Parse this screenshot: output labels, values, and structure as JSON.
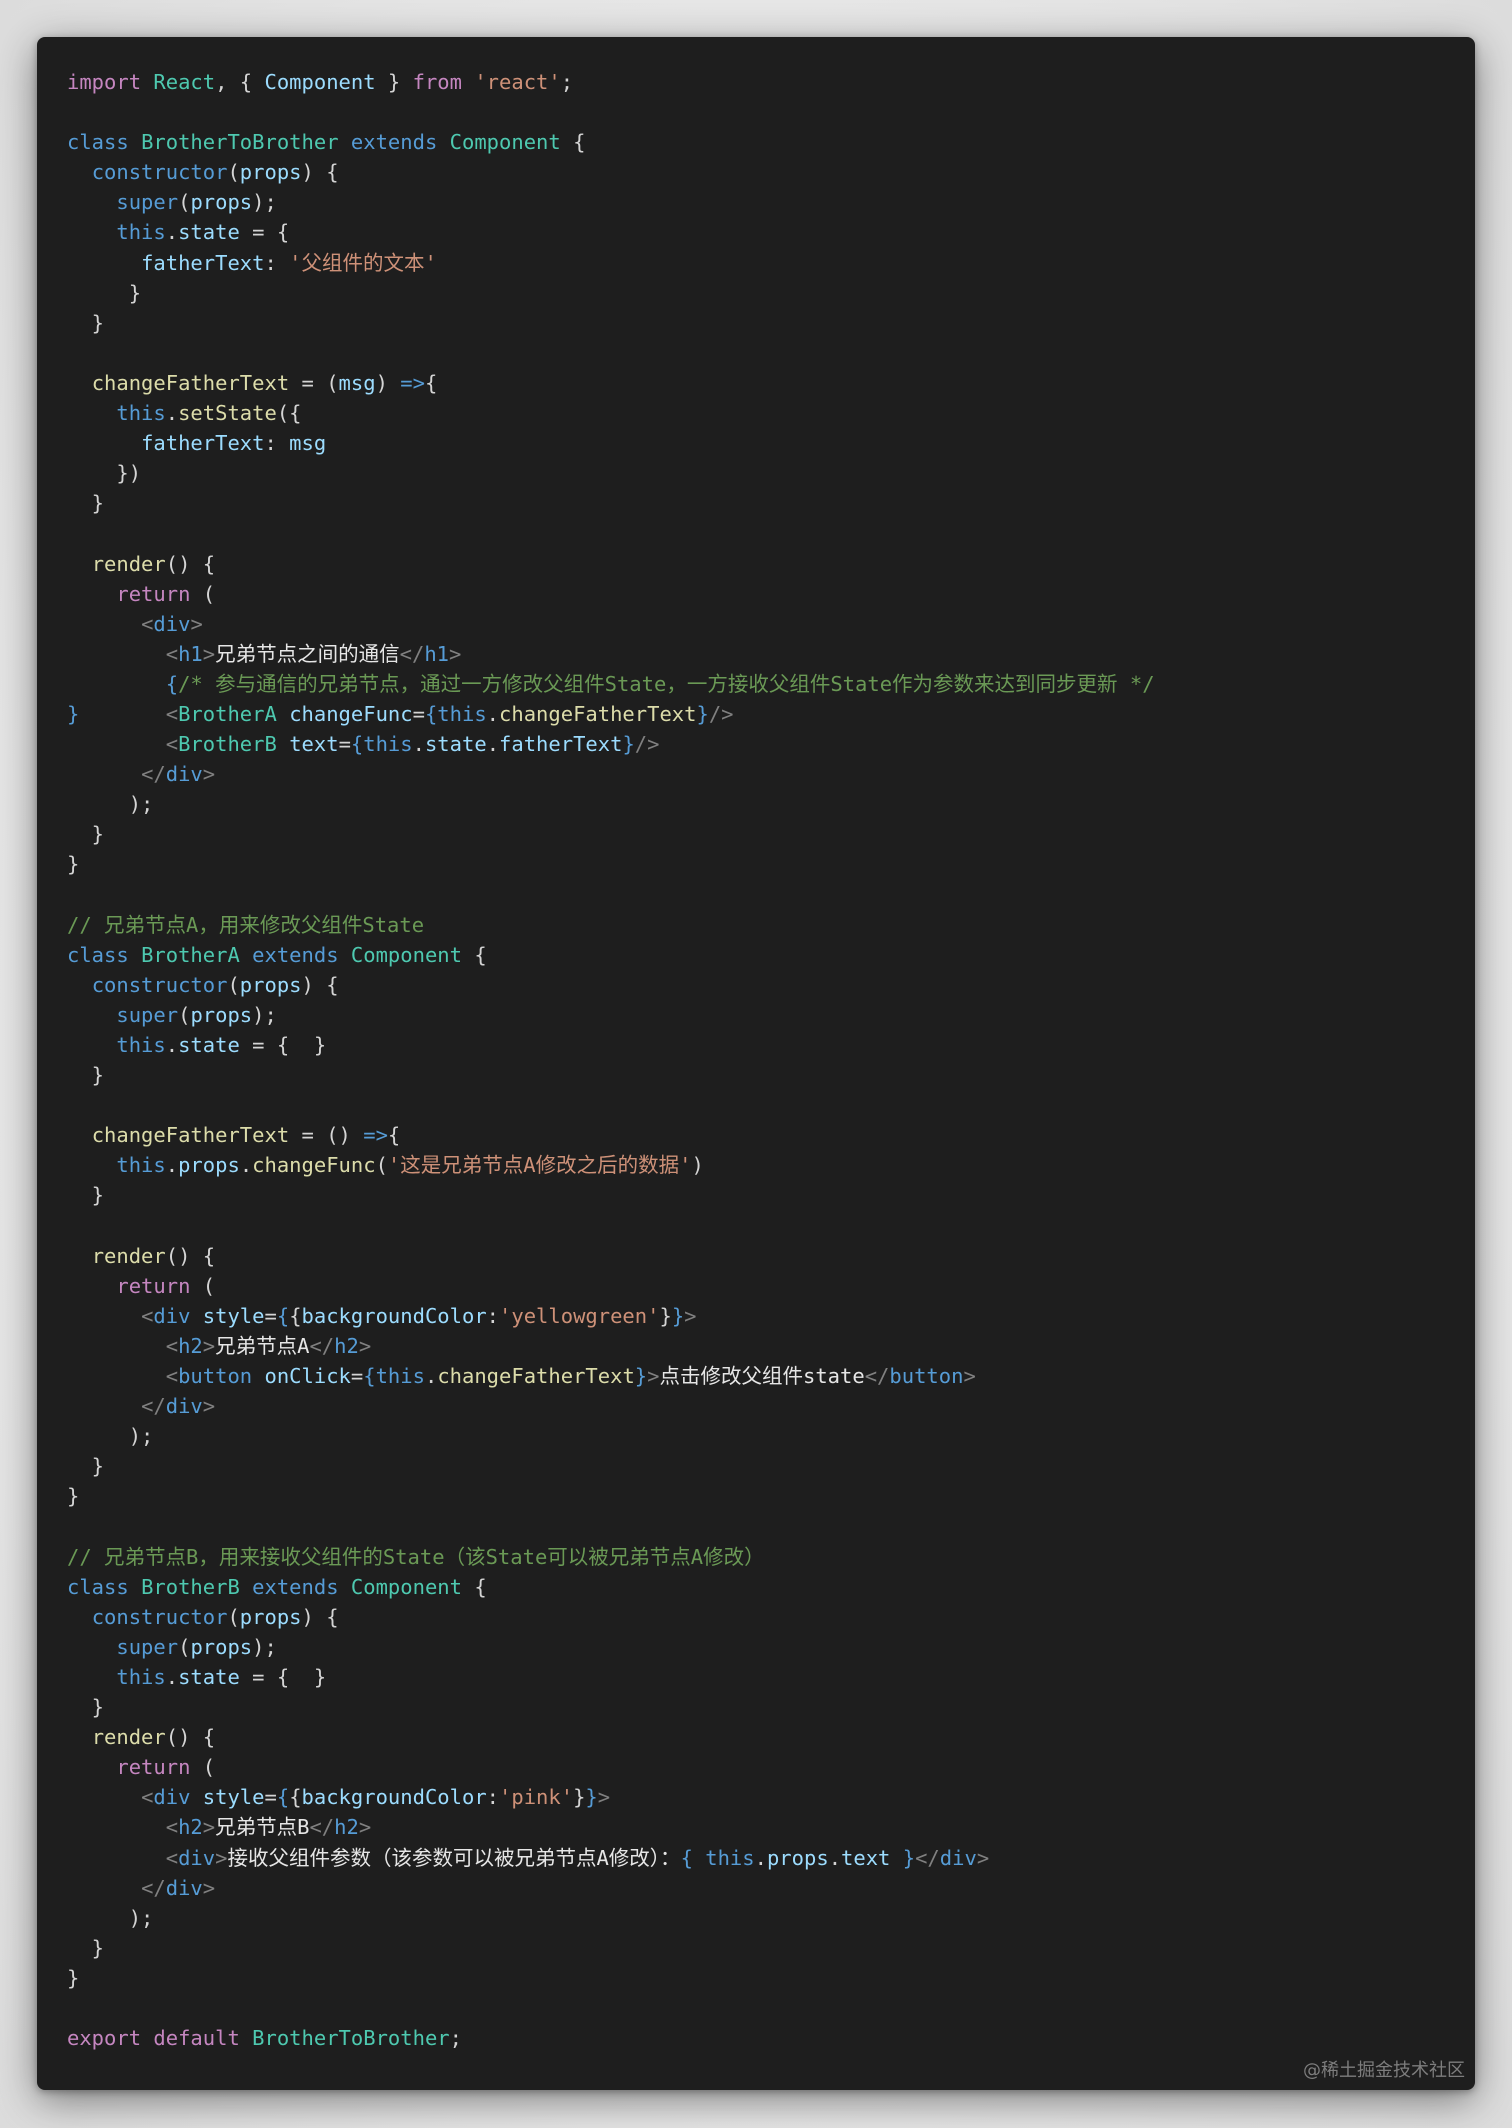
{
  "colors": {
    "background": "#1e1e1e",
    "keyword": "#c586c0",
    "declaration": "#569cd6",
    "type": "#4ec9b0",
    "function": "#dcdcaa",
    "variable": "#9cdcfe",
    "string": "#ce9178",
    "comment": "#6a9955",
    "tag": "#569cd6",
    "tag_bracket": "#808080",
    "text": "#d4d4d4"
  },
  "watermark": "@稀土掘金技术社区",
  "code_lines": [
    [
      [
        "kw",
        "import"
      ],
      [
        "p",
        " "
      ],
      [
        "type",
        "React"
      ],
      [
        "p",
        ", { "
      ],
      [
        "var",
        "Component"
      ],
      [
        "p",
        " } "
      ],
      [
        "kw",
        "from"
      ],
      [
        "p",
        " "
      ],
      [
        "str",
        "'react'"
      ],
      [
        "p",
        ";"
      ]
    ],
    [],
    [
      [
        "decl",
        "class"
      ],
      [
        "p",
        " "
      ],
      [
        "type",
        "BrotherToBrother"
      ],
      [
        "p",
        " "
      ],
      [
        "decl",
        "extends"
      ],
      [
        "p",
        " "
      ],
      [
        "type",
        "Component"
      ],
      [
        "p",
        " {"
      ]
    ],
    [
      [
        "p",
        "  "
      ],
      [
        "decl",
        "constructor"
      ],
      [
        "p",
        "("
      ],
      [
        "var",
        "props"
      ],
      [
        "p",
        ") {"
      ]
    ],
    [
      [
        "p",
        "    "
      ],
      [
        "decl",
        "super"
      ],
      [
        "p",
        "("
      ],
      [
        "var",
        "props"
      ],
      [
        "p",
        ");"
      ]
    ],
    [
      [
        "p",
        "    "
      ],
      [
        "decl",
        "this"
      ],
      [
        "p",
        "."
      ],
      [
        "var",
        "state"
      ],
      [
        "p",
        " = {"
      ]
    ],
    [
      [
        "p",
        "      "
      ],
      [
        "var",
        "fatherText"
      ],
      [
        "p",
        ": "
      ],
      [
        "str",
        "'父组件的文本'"
      ]
    ],
    [
      [
        "p",
        "     }"
      ]
    ],
    [
      [
        "p",
        "  }"
      ]
    ],
    [],
    [
      [
        "p",
        "  "
      ],
      [
        "fn",
        "changeFatherText"
      ],
      [
        "p",
        " = ("
      ],
      [
        "var",
        "msg"
      ],
      [
        "p",
        ") "
      ],
      [
        "decl",
        "=>"
      ],
      [
        "p",
        "{"
      ]
    ],
    [
      [
        "p",
        "    "
      ],
      [
        "decl",
        "this"
      ],
      [
        "p",
        "."
      ],
      [
        "fn",
        "setState"
      ],
      [
        "p",
        "({"
      ]
    ],
    [
      [
        "p",
        "      "
      ],
      [
        "var",
        "fatherText"
      ],
      [
        "p",
        ": "
      ],
      [
        "var",
        "msg"
      ]
    ],
    [
      [
        "p",
        "    })"
      ]
    ],
    [
      [
        "p",
        "  }"
      ]
    ],
    [],
    [
      [
        "p",
        "  "
      ],
      [
        "fn",
        "render"
      ],
      [
        "p",
        "() {"
      ]
    ],
    [
      [
        "p",
        "    "
      ],
      [
        "kw",
        "return"
      ],
      [
        "p",
        " ("
      ]
    ],
    [
      [
        "p",
        "      "
      ],
      [
        "brk",
        "<"
      ],
      [
        "tag",
        "div"
      ],
      [
        "brk",
        ">"
      ]
    ],
    [
      [
        "p",
        "        "
      ],
      [
        "brk",
        "<"
      ],
      [
        "tag",
        "h1"
      ],
      [
        "brk",
        ">"
      ],
      [
        "t",
        "兄弟节点之间的通信"
      ],
      [
        "brk",
        "</"
      ],
      [
        "tag",
        "h1"
      ],
      [
        "brk",
        ">"
      ]
    ],
    [
      [
        "p",
        "        "
      ],
      [
        "decl",
        "{"
      ],
      [
        "com",
        "/* 参与通信的兄弟节点，通过一方修改父组件State，一方接收父组件State作为参数来达到同步更新 */"
      ]
    ],
    [
      [
        "decl",
        "}"
      ],
      [
        "p",
        "       "
      ],
      [
        "brk",
        "<"
      ],
      [
        "type",
        "BrotherA"
      ],
      [
        "p",
        " "
      ],
      [
        "var",
        "changeFunc"
      ],
      [
        "p",
        "="
      ],
      [
        "decl",
        "{this"
      ],
      [
        "p",
        "."
      ],
      [
        "fn",
        "changeFatherText"
      ],
      [
        "decl",
        "}"
      ],
      [
        "brk",
        "/>"
      ]
    ],
    [
      [
        "p",
        "        "
      ],
      [
        "brk",
        "<"
      ],
      [
        "type",
        "BrotherB"
      ],
      [
        "p",
        " "
      ],
      [
        "var",
        "text"
      ],
      [
        "p",
        "="
      ],
      [
        "decl",
        "{this"
      ],
      [
        "p",
        "."
      ],
      [
        "var",
        "state"
      ],
      [
        "p",
        "."
      ],
      [
        "var",
        "fatherText"
      ],
      [
        "decl",
        "}"
      ],
      [
        "brk",
        "/>"
      ]
    ],
    [
      [
        "p",
        "      "
      ],
      [
        "brk",
        "</"
      ],
      [
        "tag",
        "div"
      ],
      [
        "brk",
        ">"
      ]
    ],
    [
      [
        "p",
        "     );"
      ]
    ],
    [
      [
        "p",
        "  }"
      ]
    ],
    [
      [
        "p",
        "}"
      ]
    ],
    [],
    [
      [
        "com",
        "// 兄弟节点A，用来修改父组件State"
      ]
    ],
    [
      [
        "decl",
        "class"
      ],
      [
        "p",
        " "
      ],
      [
        "type",
        "BrotherA"
      ],
      [
        "p",
        " "
      ],
      [
        "decl",
        "extends"
      ],
      [
        "p",
        " "
      ],
      [
        "type",
        "Component"
      ],
      [
        "p",
        " {"
      ]
    ],
    [
      [
        "p",
        "  "
      ],
      [
        "decl",
        "constructor"
      ],
      [
        "p",
        "("
      ],
      [
        "var",
        "props"
      ],
      [
        "p",
        ") {"
      ]
    ],
    [
      [
        "p",
        "    "
      ],
      [
        "decl",
        "super"
      ],
      [
        "p",
        "("
      ],
      [
        "var",
        "props"
      ],
      [
        "p",
        ");"
      ]
    ],
    [
      [
        "p",
        "    "
      ],
      [
        "decl",
        "this"
      ],
      [
        "p",
        "."
      ],
      [
        "var",
        "state"
      ],
      [
        "p",
        " = {  }"
      ]
    ],
    [
      [
        "p",
        "  }"
      ]
    ],
    [],
    [
      [
        "p",
        "  "
      ],
      [
        "fn",
        "changeFatherText"
      ],
      [
        "p",
        " = () "
      ],
      [
        "decl",
        "=>"
      ],
      [
        "p",
        "{"
      ]
    ],
    [
      [
        "p",
        "    "
      ],
      [
        "decl",
        "this"
      ],
      [
        "p",
        "."
      ],
      [
        "var",
        "props"
      ],
      [
        "p",
        "."
      ],
      [
        "fn",
        "changeFunc"
      ],
      [
        "p",
        "("
      ],
      [
        "str",
        "'这是兄弟节点A修改之后的数据'"
      ],
      [
        "p",
        ")"
      ]
    ],
    [
      [
        "p",
        "  }"
      ]
    ],
    [],
    [
      [
        "p",
        "  "
      ],
      [
        "fn",
        "render"
      ],
      [
        "p",
        "() {"
      ]
    ],
    [
      [
        "p",
        "    "
      ],
      [
        "kw",
        "return"
      ],
      [
        "p",
        " ("
      ]
    ],
    [
      [
        "p",
        "      "
      ],
      [
        "brk",
        "<"
      ],
      [
        "tag",
        "div"
      ],
      [
        "p",
        " "
      ],
      [
        "var",
        "style"
      ],
      [
        "p",
        "="
      ],
      [
        "decl",
        "{"
      ],
      [
        "p",
        "{"
      ],
      [
        "var",
        "backgroundColor"
      ],
      [
        "p",
        ":"
      ],
      [
        "str",
        "'yellowgreen'"
      ],
      [
        "p",
        "}"
      ],
      [
        "decl",
        "}"
      ],
      [
        "brk",
        ">"
      ]
    ],
    [
      [
        "p",
        "        "
      ],
      [
        "brk",
        "<"
      ],
      [
        "tag",
        "h2"
      ],
      [
        "brk",
        ">"
      ],
      [
        "t",
        "兄弟节点A"
      ],
      [
        "brk",
        "</"
      ],
      [
        "tag",
        "h2"
      ],
      [
        "brk",
        ">"
      ]
    ],
    [
      [
        "p",
        "        "
      ],
      [
        "brk",
        "<"
      ],
      [
        "tag",
        "button"
      ],
      [
        "p",
        " "
      ],
      [
        "var",
        "onClick"
      ],
      [
        "p",
        "="
      ],
      [
        "decl",
        "{this"
      ],
      [
        "p",
        "."
      ],
      [
        "fn",
        "changeFatherText"
      ],
      [
        "decl",
        "}"
      ],
      [
        "brk",
        ">"
      ],
      [
        "t",
        "点击修改父组件state"
      ],
      [
        "brk",
        "</"
      ],
      [
        "tag",
        "button"
      ],
      [
        "brk",
        ">"
      ]
    ],
    [
      [
        "p",
        "      "
      ],
      [
        "brk",
        "</"
      ],
      [
        "tag",
        "div"
      ],
      [
        "brk",
        ">"
      ]
    ],
    [
      [
        "p",
        "     );"
      ]
    ],
    [
      [
        "p",
        "  }"
      ]
    ],
    [
      [
        "p",
        "}"
      ]
    ],
    [],
    [
      [
        "com",
        "// 兄弟节点B，用来接收父组件的State（该State可以被兄弟节点A修改）"
      ]
    ],
    [
      [
        "decl",
        "class"
      ],
      [
        "p",
        " "
      ],
      [
        "type",
        "BrotherB"
      ],
      [
        "p",
        " "
      ],
      [
        "decl",
        "extends"
      ],
      [
        "p",
        " "
      ],
      [
        "type",
        "Component"
      ],
      [
        "p",
        " {"
      ]
    ],
    [
      [
        "p",
        "  "
      ],
      [
        "decl",
        "constructor"
      ],
      [
        "p",
        "("
      ],
      [
        "var",
        "props"
      ],
      [
        "p",
        ") {"
      ]
    ],
    [
      [
        "p",
        "    "
      ],
      [
        "decl",
        "super"
      ],
      [
        "p",
        "("
      ],
      [
        "var",
        "props"
      ],
      [
        "p",
        ");"
      ]
    ],
    [
      [
        "p",
        "    "
      ],
      [
        "decl",
        "this"
      ],
      [
        "p",
        "."
      ],
      [
        "var",
        "state"
      ],
      [
        "p",
        " = {  }"
      ]
    ],
    [
      [
        "p",
        "  }"
      ]
    ],
    [
      [
        "p",
        "  "
      ],
      [
        "fn",
        "render"
      ],
      [
        "p",
        "() {"
      ]
    ],
    [
      [
        "p",
        "    "
      ],
      [
        "kw",
        "return"
      ],
      [
        "p",
        " ("
      ]
    ],
    [
      [
        "p",
        "      "
      ],
      [
        "brk",
        "<"
      ],
      [
        "tag",
        "div"
      ],
      [
        "p",
        " "
      ],
      [
        "var",
        "style"
      ],
      [
        "p",
        "="
      ],
      [
        "decl",
        "{"
      ],
      [
        "p",
        "{"
      ],
      [
        "var",
        "backgroundColor"
      ],
      [
        "p",
        ":"
      ],
      [
        "str",
        "'pink'"
      ],
      [
        "p",
        "}"
      ],
      [
        "decl",
        "}"
      ],
      [
        "brk",
        ">"
      ]
    ],
    [
      [
        "p",
        "        "
      ],
      [
        "brk",
        "<"
      ],
      [
        "tag",
        "h2"
      ],
      [
        "brk",
        ">"
      ],
      [
        "t",
        "兄弟节点B"
      ],
      [
        "brk",
        "</"
      ],
      [
        "tag",
        "h2"
      ],
      [
        "brk",
        ">"
      ]
    ],
    [
      [
        "p",
        "        "
      ],
      [
        "brk",
        "<"
      ],
      [
        "tag",
        "div"
      ],
      [
        "brk",
        ">"
      ],
      [
        "t",
        "接收父组件参数（该参数可以被兄弟节点A修改）："
      ],
      [
        "decl",
        "{ this"
      ],
      [
        "p",
        "."
      ],
      [
        "var",
        "props"
      ],
      [
        "p",
        "."
      ],
      [
        "var",
        "text"
      ],
      [
        "p",
        " "
      ],
      [
        "decl",
        "}"
      ],
      [
        "brk",
        "</"
      ],
      [
        "tag",
        "div"
      ],
      [
        "brk",
        ">"
      ]
    ],
    [
      [
        "p",
        "      "
      ],
      [
        "brk",
        "</"
      ],
      [
        "tag",
        "div"
      ],
      [
        "brk",
        ">"
      ]
    ],
    [
      [
        "p",
        "     );"
      ]
    ],
    [
      [
        "p",
        "  }"
      ]
    ],
    [
      [
        "p",
        "}"
      ]
    ],
    [],
    [
      [
        "kw",
        "export"
      ],
      [
        "p",
        " "
      ],
      [
        "kw",
        "default"
      ],
      [
        "p",
        " "
      ],
      [
        "type",
        "BrotherToBrother"
      ],
      [
        "p",
        ";"
      ]
    ]
  ]
}
